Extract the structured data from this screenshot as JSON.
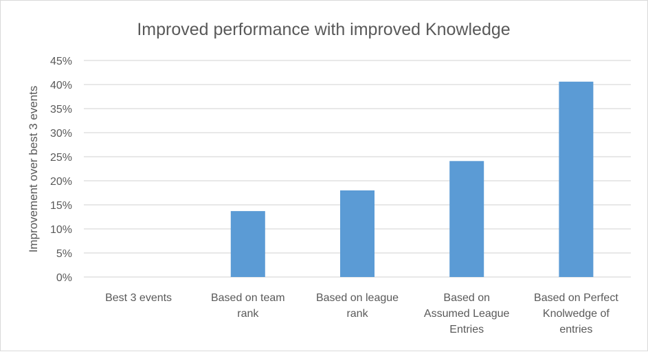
{
  "chart_data": {
    "type": "bar",
    "title": "Improved performance  with improved Knowledge",
    "xlabel": "",
    "ylabel": "Improvement over best 3 events",
    "ylim": [
      0,
      0.45
    ],
    "yticks": [
      "0%",
      "5%",
      "10%",
      "15%",
      "20%",
      "25%",
      "30%",
      "35%",
      "40%",
      "45%"
    ],
    "grid": true,
    "bar_color": "#5b9bd5",
    "categories": [
      [
        "Best 3 events"
      ],
      [
        "Based on team",
        "rank"
      ],
      [
        "Based on league",
        "rank"
      ],
      [
        "Based on",
        "Assumed League",
        "Entries"
      ],
      [
        "Based on Perfect",
        "Knolwedge of",
        "entries"
      ]
    ],
    "values": [
      0,
      0.137,
      0.18,
      0.241,
      0.406
    ]
  }
}
